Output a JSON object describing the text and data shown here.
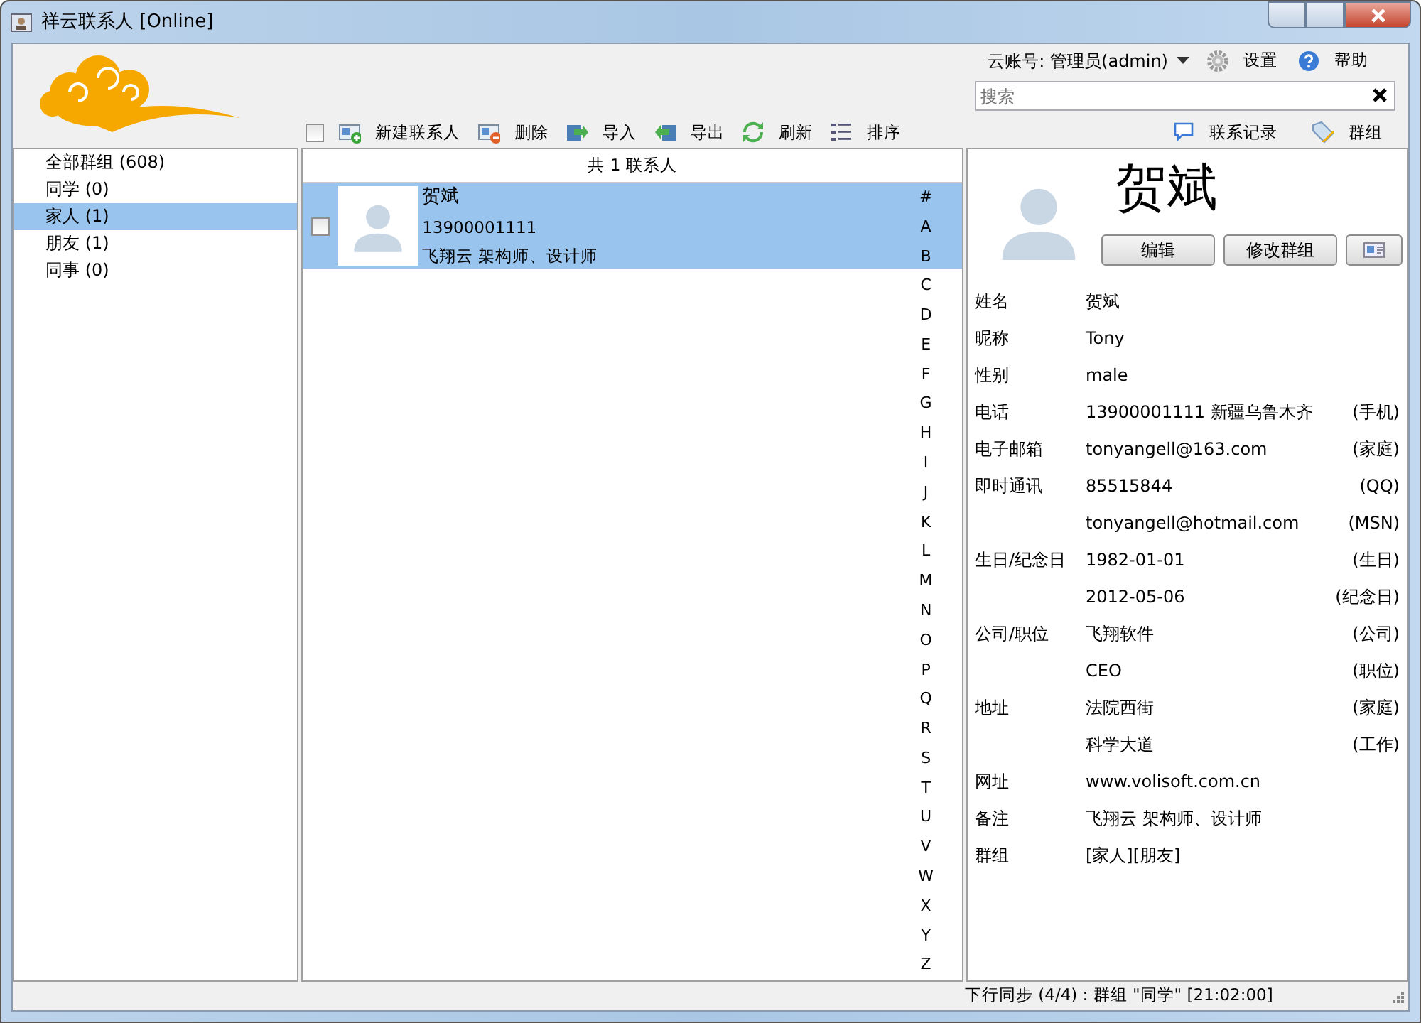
{
  "window": {
    "title": "祥云联系人 [Online]"
  },
  "account": {
    "label": "云账号: 管理员(admin)",
    "settings": "设置",
    "help": "帮助"
  },
  "search": {
    "placeholder": "搜索"
  },
  "toolbar": {
    "select_all_checked": false,
    "buttons": [
      {
        "kind": "new",
        "label": "新建联系人"
      },
      {
        "kind": "delete",
        "label": "删除"
      },
      {
        "kind": "import",
        "label": "导入"
      },
      {
        "kind": "export",
        "label": "导出"
      },
      {
        "kind": "refresh",
        "label": "刷新"
      },
      {
        "kind": "sort",
        "label": "排序"
      }
    ]
  },
  "right_toolbar": [
    {
      "kind": "history",
      "label": "联系记录"
    },
    {
      "kind": "groups",
      "label": "群组"
    }
  ],
  "groups": [
    {
      "label": "全部群组 (608)",
      "selected": false
    },
    {
      "label": "同学 (0)",
      "selected": false
    },
    {
      "label": "家人 (1)",
      "selected": true
    },
    {
      "label": "朋友 (1)",
      "selected": false
    },
    {
      "label": "同事 (0)",
      "selected": false
    }
  ],
  "contact_list": {
    "header": "共 1 联系人",
    "contacts": [
      {
        "name": "贺斌",
        "phone": "13900001111",
        "note": "飞翔云 架构师、设计师",
        "selected": true,
        "checked": false
      }
    ],
    "index": [
      "#",
      "A",
      "B",
      "C",
      "D",
      "E",
      "F",
      "G",
      "H",
      "I",
      "J",
      "K",
      "L",
      "M",
      "N",
      "O",
      "P",
      "Q",
      "R",
      "S",
      "T",
      "U",
      "V",
      "W",
      "X",
      "Y",
      "Z"
    ]
  },
  "detail": {
    "name": "贺斌",
    "buttons": [
      {
        "kind": "text",
        "label": "编辑"
      },
      {
        "kind": "text",
        "label": "修改群组"
      },
      {
        "kind": "card"
      }
    ],
    "fields": [
      {
        "label": "姓名",
        "value": "贺斌"
      },
      {
        "label": "昵称",
        "value": "Tony"
      },
      {
        "label": "性别",
        "value": "male"
      },
      {
        "label": "电话",
        "value": "13900001111 新疆乌鲁木齐",
        "type": "(手机)"
      },
      {
        "label": "电子邮箱",
        "value": "tonyangell@163.com",
        "type": "(家庭)"
      },
      {
        "label": "即时通讯",
        "value": "85515844",
        "type": "(QQ)"
      },
      {
        "value": "tonyangell@hotmail.com",
        "type": "(MSN)"
      },
      {
        "label": "生日/纪念日",
        "value": "1982-01-01",
        "type": "(生日)"
      },
      {
        "value": "2012-05-06",
        "type": "(纪念日)"
      },
      {
        "label": "公司/职位",
        "value": "飞翔软件",
        "type": "(公司)"
      },
      {
        "value": "CEO",
        "type": "(职位)"
      },
      {
        "label": "地址",
        "value": "法院西街",
        "type": "(家庭)"
      },
      {
        "value": "科学大道",
        "type": "(工作)"
      },
      {
        "label": "网址",
        "value": "www.volisoft.com.cn"
      },
      {
        "label": "备注",
        "value": "飞翔云 架构师、设计师"
      },
      {
        "label": "群组",
        "value": "[家人][朋友]"
      }
    ]
  },
  "status_bar": {
    "text": "下行同步 (4/4) : 群组 \"同学\" [21:02:00]"
  }
}
